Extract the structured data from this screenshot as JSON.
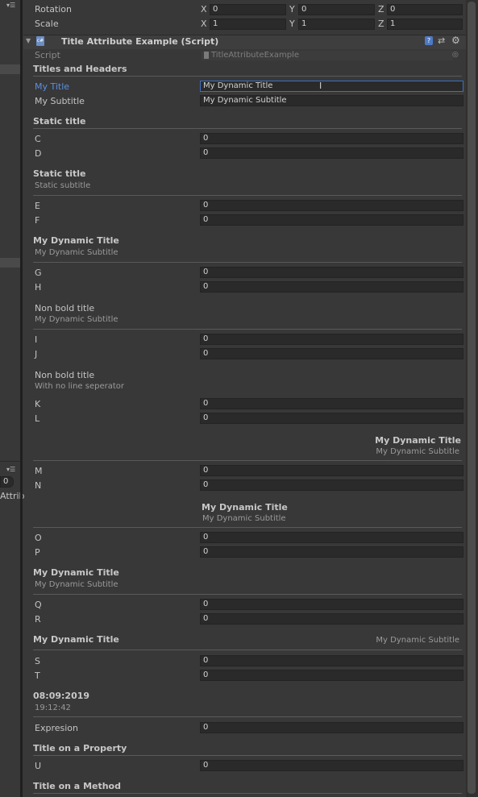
{
  "transform": {
    "rotation_label": "Rotation",
    "scale_label": "Scale",
    "rotation": {
      "x": "0",
      "y": "0",
      "z": "0"
    },
    "scale": {
      "x": "1",
      "y": "1",
      "z": "1"
    },
    "axis_x": "X",
    "axis_y": "Y",
    "axis_z": "Z"
  },
  "component": {
    "title": "Title Attribute Example (Script)",
    "script_label": "Script",
    "script_value": "TitleAttributeExample"
  },
  "sections": {
    "titles_headers": "Titles and Headers",
    "my_title_label": "My Title",
    "my_title_value": "My Dynamic Title",
    "my_subtitle_label": "My Subtitle",
    "my_subtitle_value": "My Dynamic Subtitle",
    "static_title_1": "Static title",
    "static_title_2": "Static title",
    "static_subtitle": "Static subtitle",
    "dyn_title_1": "My Dynamic Title",
    "dyn_sub_1": "My Dynamic Subtitle",
    "nonbold_title_1": "Non bold title",
    "nonbold_sub_1": "My Dynamic Subtitle",
    "nonbold_title_2": "Non bold title",
    "nonbold_sub_2": "With no line seperator",
    "dyn_title_right": "My Dynamic Title",
    "dyn_sub_right": "My Dynamic Subtitle",
    "dyn_title_center": "My Dynamic Title",
    "dyn_sub_center": "My Dynamic Subtitle",
    "dyn_title_3": "My Dynamic Title",
    "dyn_sub_3": "My Dynamic Subtitle",
    "dyn_title_4": "My Dynamic Title",
    "dyn_sub_4_right": "My Dynamic Subtitle",
    "date_title": "08:09:2019",
    "time_sub": "19:12:42",
    "expresion_label": "Expresion",
    "title_on_property": "Title on a Property",
    "title_on_method": "Title on a Method"
  },
  "fields": {
    "C": "0",
    "D": "0",
    "E": "0",
    "F": "0",
    "G": "0",
    "H": "0",
    "I": "0",
    "J": "0",
    "K": "0",
    "L": "0",
    "M": "0",
    "N": "0",
    "O": "0",
    "P": "0",
    "Q": "0",
    "R": "0",
    "S": "0",
    "T": "0",
    "U": "0",
    "Expresion": "0"
  },
  "labels": {
    "C": "C",
    "D": "D",
    "E": "E",
    "F": "F",
    "G": "G",
    "H": "H",
    "I": "I",
    "J": "J",
    "K": "K",
    "L": "L",
    "M": "M",
    "N": "N",
    "O": "O",
    "P": "P",
    "Q": "Q",
    "R": "R",
    "S": "S",
    "T": "T",
    "U": "U"
  },
  "left_panel": {
    "field_value": "0",
    "cut_text": "Attrib"
  },
  "icons": [
    "menu-icon",
    "script-icon",
    "help-icon",
    "preset-icon",
    "gear-icon",
    "foldout-arrow-icon",
    "object-picker-icon"
  ],
  "colors": {
    "accent": "#3d6fbf",
    "background": "#383838"
  }
}
